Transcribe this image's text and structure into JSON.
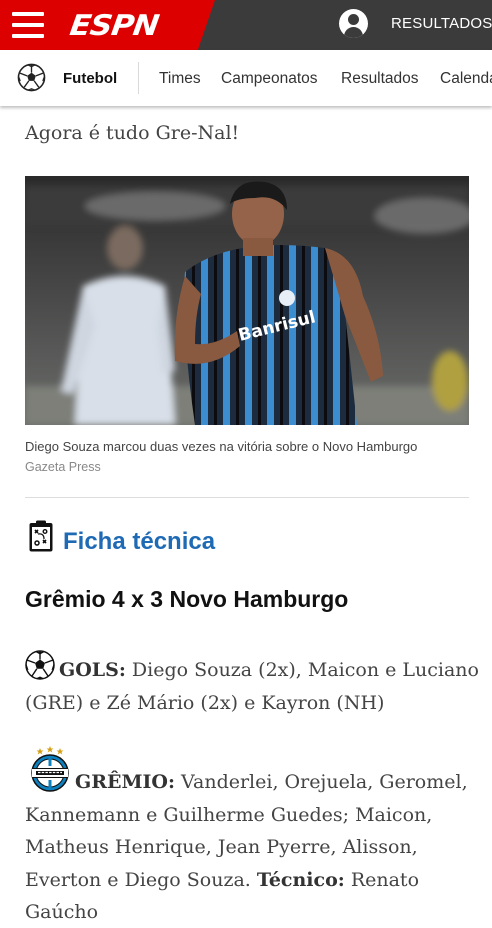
{
  "header": {
    "logo": "ESPN",
    "results_label": "RESULTADOS"
  },
  "subnav": {
    "sport": "Futebol",
    "items": [
      "Times",
      "Campeonatos",
      "Resultados",
      "Calendário"
    ]
  },
  "article": {
    "lead": "Agora é tudo Gre-Nal!",
    "photo_caption": "Diego Souza marcou duas vezes na vitória sobre o Novo Hamburgo",
    "photo_credit": "Gazeta Press",
    "ficha_title": "Ficha técnica",
    "score": "Grêmio 4 x 3 Novo Hamburgo",
    "gols_label": "GOLS:",
    "gols_text": " Diego Souza (2x), Maicon e Luciano (GRE) e Zé Mário (2x) e Kayron (NH)",
    "gremio_label": "GRÊMIO:",
    "gremio_text": " Vanderlei, Orejuela, Geromel, Kannemann e Guilherme Guedes; Maicon, Matheus Henrique, Jean Pyerre, Alisson, Everton e Diego Souza. ",
    "tecnico_label": "Técnico:",
    "tecnico_text": " Renato Gaúcho"
  },
  "colors": {
    "header_red": "#dd0000",
    "header_dark": "#3b3b3b",
    "ficha_blue": "#1f6ab5",
    "gremio_blue": "#0d80bf"
  }
}
